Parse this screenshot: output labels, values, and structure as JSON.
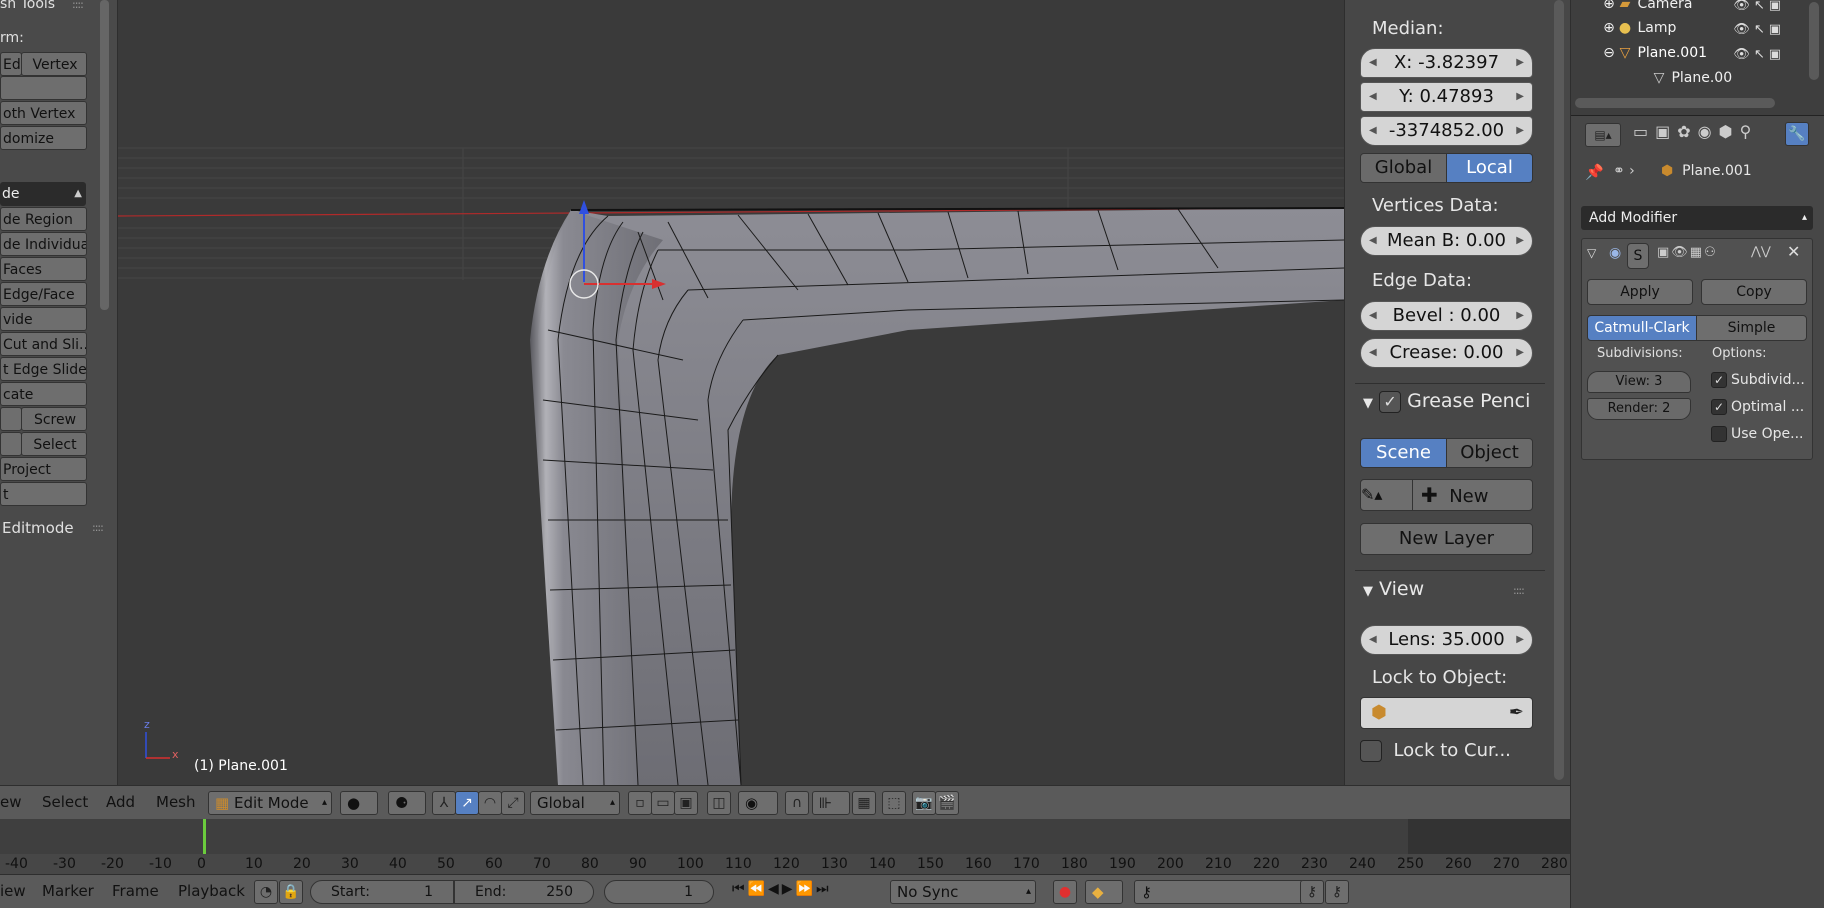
{
  "toolshelf": {
    "title": "sh Tools",
    "transform_label": "rm:",
    "row1": [
      "Ed",
      "Vertex"
    ],
    "items": [
      "",
      "oth Vertex",
      "domize"
    ],
    "extrude_dropdown": "de",
    "extrude_items": [
      "de Region",
      "de Individual",
      "Faces",
      "Edge/Face",
      "vide",
      "Cut and Sli...",
      "t Edge Slide",
      "cate"
    ],
    "row_screw": [
      "",
      "Screw"
    ],
    "row_select": [
      "",
      "Select"
    ],
    "project": "Project",
    "last": "t",
    "editmode": "Editmode"
  },
  "viewport": {
    "object_label": "(1) Plane.001",
    "axis_z": "z",
    "axis_x": "x"
  },
  "npanel": {
    "median_label": "Median:",
    "x_field": "X:  -3.82397",
    "y_field": "Y:   0.47893",
    "z_field": "-3374852.00",
    "space": [
      "Global",
      "Local"
    ],
    "space_active": "Local",
    "vertices_data_label": "Vertices Data:",
    "mean_b": "Mean B: 0.00",
    "edge_data_label": "Edge Data:",
    "bevel": "Bevel :   0.00",
    "crease": "Crease:  0.00",
    "grease_pencil_title": "Grease Penci",
    "gp_source": [
      "Scene",
      "Object"
    ],
    "gp_source_active": "Scene",
    "gp_new": "New",
    "gp_new_layer": "New Layer",
    "view_title": "View",
    "lens": "Lens: 35.000",
    "lock_to_object": "Lock to Object:",
    "lock_to_cursor": "Lock to Cur..."
  },
  "outliner": {
    "rows": [
      {
        "label": "Camera",
        "icon": "camera-icon"
      },
      {
        "label": "Lamp",
        "icon": "lamp-icon"
      },
      {
        "label": "Plane.001",
        "icon": "mesh-icon"
      },
      {
        "label": "Plane.00",
        "icon": "mesh-data-icon"
      }
    ]
  },
  "properties": {
    "object_name": "Plane.001",
    "add_modifier": "Add Modifier",
    "modifier_name": "S",
    "apply": "Apply",
    "copy": "Copy",
    "subdiv_types": [
      "Catmull-Clark",
      "Simple"
    ],
    "subdiv_active": "Catmull-Clark",
    "subdivisions_label": "Subdivisions:",
    "options_label": "Options:",
    "view_levels": "View:   3",
    "render_levels": "Render: 2",
    "options": [
      {
        "label": "Subdivid...",
        "checked": true
      },
      {
        "label": "Optimal ...",
        "checked": true
      },
      {
        "label": "Use Ope...",
        "checked": false
      }
    ]
  },
  "header": {
    "menus": [
      "ew",
      "Select",
      "Add",
      "Mesh"
    ],
    "mode": "Edit Mode",
    "orientation": "Global"
  },
  "timeline": {
    "ticks": [
      "-40",
      "-30",
      "-20",
      "-10",
      "0",
      "10",
      "20",
      "30",
      "40",
      "50",
      "60",
      "70",
      "80",
      "90",
      "100",
      "110",
      "120",
      "130",
      "140",
      "150",
      "160",
      "170",
      "180",
      "190",
      "200",
      "210",
      "220",
      "230",
      "240",
      "250",
      "260",
      "270",
      "280"
    ]
  },
  "bottombar": {
    "menus": [
      "iew",
      "Marker",
      "Frame",
      "Playback"
    ],
    "start": "Start:",
    "start_val": "1",
    "end": "End:",
    "end_val": "250",
    "current": "1",
    "sync": "No Sync"
  },
  "colors": {
    "accent": "#5680c2",
    "frame_cursor": "#6bcc3d",
    "axis_red": "#d83030",
    "axis_blue": "#3050e0"
  }
}
